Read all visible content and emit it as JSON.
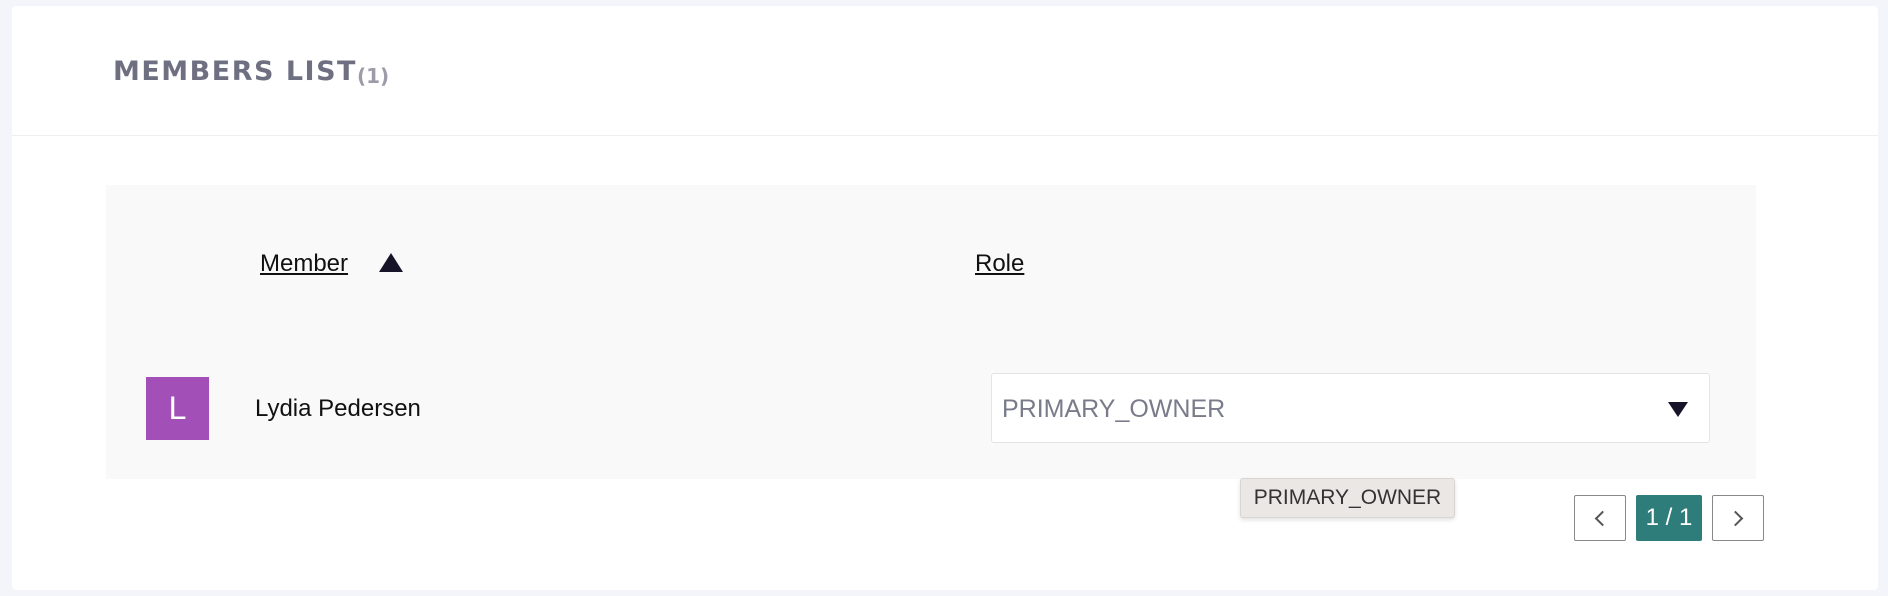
{
  "header": {
    "title": "MEMBERS LIST",
    "count": "(1)"
  },
  "table": {
    "columns": [
      {
        "label": "Member",
        "sort": "ascending"
      },
      {
        "label": "Role"
      }
    ],
    "rows": [
      {
        "avatar_letter": "L",
        "avatar_color": "#a24fb7",
        "name": "Lydia Pedersen",
        "role": "PRIMARY_OWNER"
      }
    ]
  },
  "tooltip": {
    "text": "PRIMARY_OWNER"
  },
  "pagination": {
    "current": "1 / 1",
    "accent_color": "#2f7d7a"
  }
}
